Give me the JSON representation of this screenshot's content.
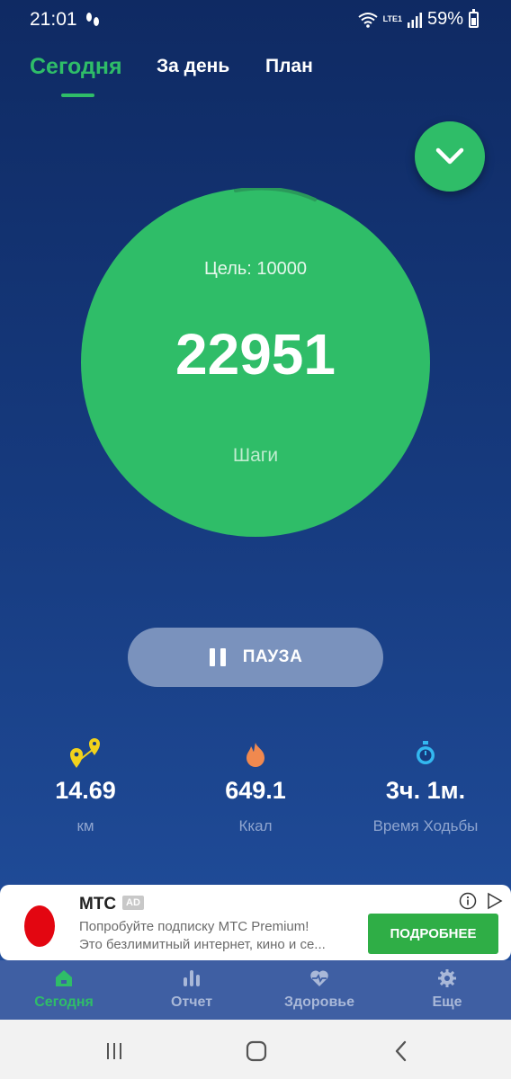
{
  "status_bar": {
    "time": "21:01",
    "battery": "59%",
    "network": "LTE1"
  },
  "tabs": [
    {
      "label": "Сегодня",
      "active": true
    },
    {
      "label": "За день",
      "active": false
    },
    {
      "label": "План",
      "active": false
    }
  ],
  "progress": {
    "goal_text": "Цель: 10000",
    "steps": "22951",
    "label": "Шаги",
    "goal_fraction": 1.0
  },
  "pause_button": {
    "label": "ПАУЗА"
  },
  "stats": [
    {
      "value": "14.69",
      "label": "км",
      "icon": "map-pin-icon"
    },
    {
      "value": "649.1",
      "label": "Ккал",
      "icon": "flame-icon"
    },
    {
      "value": "3ч. 1м.",
      "label": "Время Ходьбы",
      "icon": "stopwatch-icon"
    }
  ],
  "ad": {
    "title": "МТС",
    "badge": "AD",
    "line1": "Попробуйте подписку МТС Premium!",
    "line2": "Это безлимитный интернет, кино и се...",
    "cta": "ПОДРОБНЕЕ"
  },
  "bottom_nav": [
    {
      "label": "Сегодня",
      "icon": "home-icon",
      "active": true
    },
    {
      "label": "Отчет",
      "icon": "bar-chart-icon",
      "active": false
    },
    {
      "label": "Здоровье",
      "icon": "heart-pulse-icon",
      "active": false
    },
    {
      "label": "Еще",
      "icon": "gear-icon",
      "active": false
    }
  ],
  "colors": {
    "accent": "#2fbd68",
    "background_top": "#0f2a63",
    "background_bottom": "#2352a2",
    "pause_button": "#7a92bd",
    "ad_cta": "#2fae46"
  }
}
